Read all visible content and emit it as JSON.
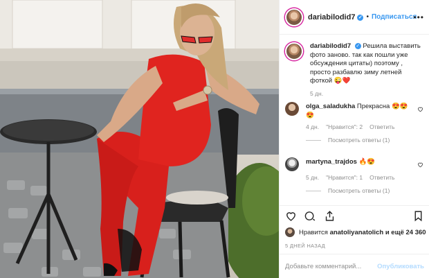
{
  "post": {
    "username": "dariabilodid7",
    "follow_label": "Подписаться",
    "separator": "•"
  },
  "caption": {
    "username": "dariabilodid7",
    "text": "Решила выставить фото заново. так как пошли уже обсуждения цитаты) поэтому , просто разбавлю зиму летней фоткой 😜❤️",
    "age": "5 дн."
  },
  "comments": [
    {
      "username": "olga_saladukha",
      "text": "Прекрасна 😍😍😍",
      "age": "4 дн.",
      "likes": "\"Нравится\": 2",
      "reply": "Ответить",
      "view_replies": "Посмотреть ответы (1)"
    },
    {
      "username": "martyna_trajdos",
      "text": "🔥😍",
      "age": "5 дн.",
      "likes": "\"Нравится\": 1",
      "reply": "Ответить",
      "view_replies": "Посмотреть ответы (1)"
    }
  ],
  "likes": {
    "prefix": "Нравится",
    "user": "anatoliyanatolich",
    "suffix": "и ещё 24 360"
  },
  "timestamp": "5 ДНЕЙ НАЗАД",
  "add_comment": {
    "placeholder": "Добавьте комментарий...",
    "publish_label": "Опубликовать"
  },
  "colors": {
    "accent": "#3897f0",
    "publish_disabled": "#b3dbff",
    "muted": "#8e8e8e",
    "jumpsuit": "#e0241f"
  }
}
